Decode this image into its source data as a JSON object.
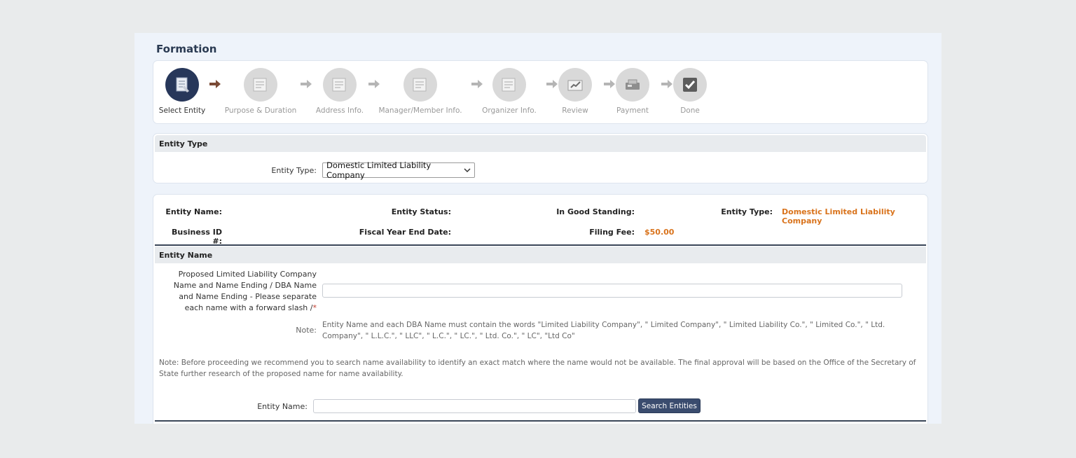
{
  "page": {
    "title": "Formation"
  },
  "steps": [
    {
      "label": "Select Entity",
      "icon": "entity-icon",
      "active": true
    },
    {
      "label": "Purpose & Duration",
      "icon": "document-icon",
      "active": false
    },
    {
      "label": "Address Info.",
      "icon": "document-icon",
      "active": false
    },
    {
      "label": "Manager/Member Info.",
      "icon": "document-icon",
      "active": false
    },
    {
      "label": "Organizer Info.",
      "icon": "document-icon",
      "active": false
    },
    {
      "label": "Review",
      "icon": "review-icon",
      "active": false
    },
    {
      "label": "Payment",
      "icon": "payment-icon",
      "active": false
    },
    {
      "label": "Done",
      "icon": "checkmark-icon",
      "active": false
    }
  ],
  "entity_type_section": {
    "heading": "Entity Type",
    "label": "Entity Type:",
    "selected": "Domestic Limited Liability Company"
  },
  "summary": {
    "entity_name_label": "Entity Name:",
    "entity_status_label": "Entity Status:",
    "good_standing_label": "In Good Standing:",
    "entity_type_label": "Entity Type:",
    "entity_type_value": "Domestic Limited Liability Company",
    "business_id_label": "Business ID #:",
    "fiscal_year_label": "Fiscal Year End Date:",
    "filing_fee_label": "Filing Fee:",
    "filing_fee_value": "$50.00"
  },
  "entity_name_section": {
    "heading": "Entity Name",
    "proposed_label": "Proposed Limited Liability Company Name and Name Ending / DBA Name and Name Ending - Please separate each name with a forward slash /",
    "required_mark": "*",
    "proposed_value": "",
    "note_label": "Note:",
    "note_text": "Entity Name and each DBA Name must contain the words \"Limited Liability Company\", \" Limited Company\", \" Limited Liability Co.\", \" Limited Co.\", \" Ltd. Company\", \" L.L.C.\", \" LLC\", \" L.C.\", \" LC.\", \" Ltd. Co.\", \" LC\", \"Ltd Co\"",
    "advice_text": "Note: Before proceeding we recommend you to search name availability to identify an exact match where the name would not be available. The final approval will be based on the Office of the Secretary of State further research of the proposed name for name availability.",
    "search_label": "Entity Name:",
    "search_value": "",
    "search_button": "Search Entities"
  },
  "colors": {
    "active_step": "#27375a",
    "accent_orange": "#d9731c",
    "button": "#3a4c6e"
  }
}
